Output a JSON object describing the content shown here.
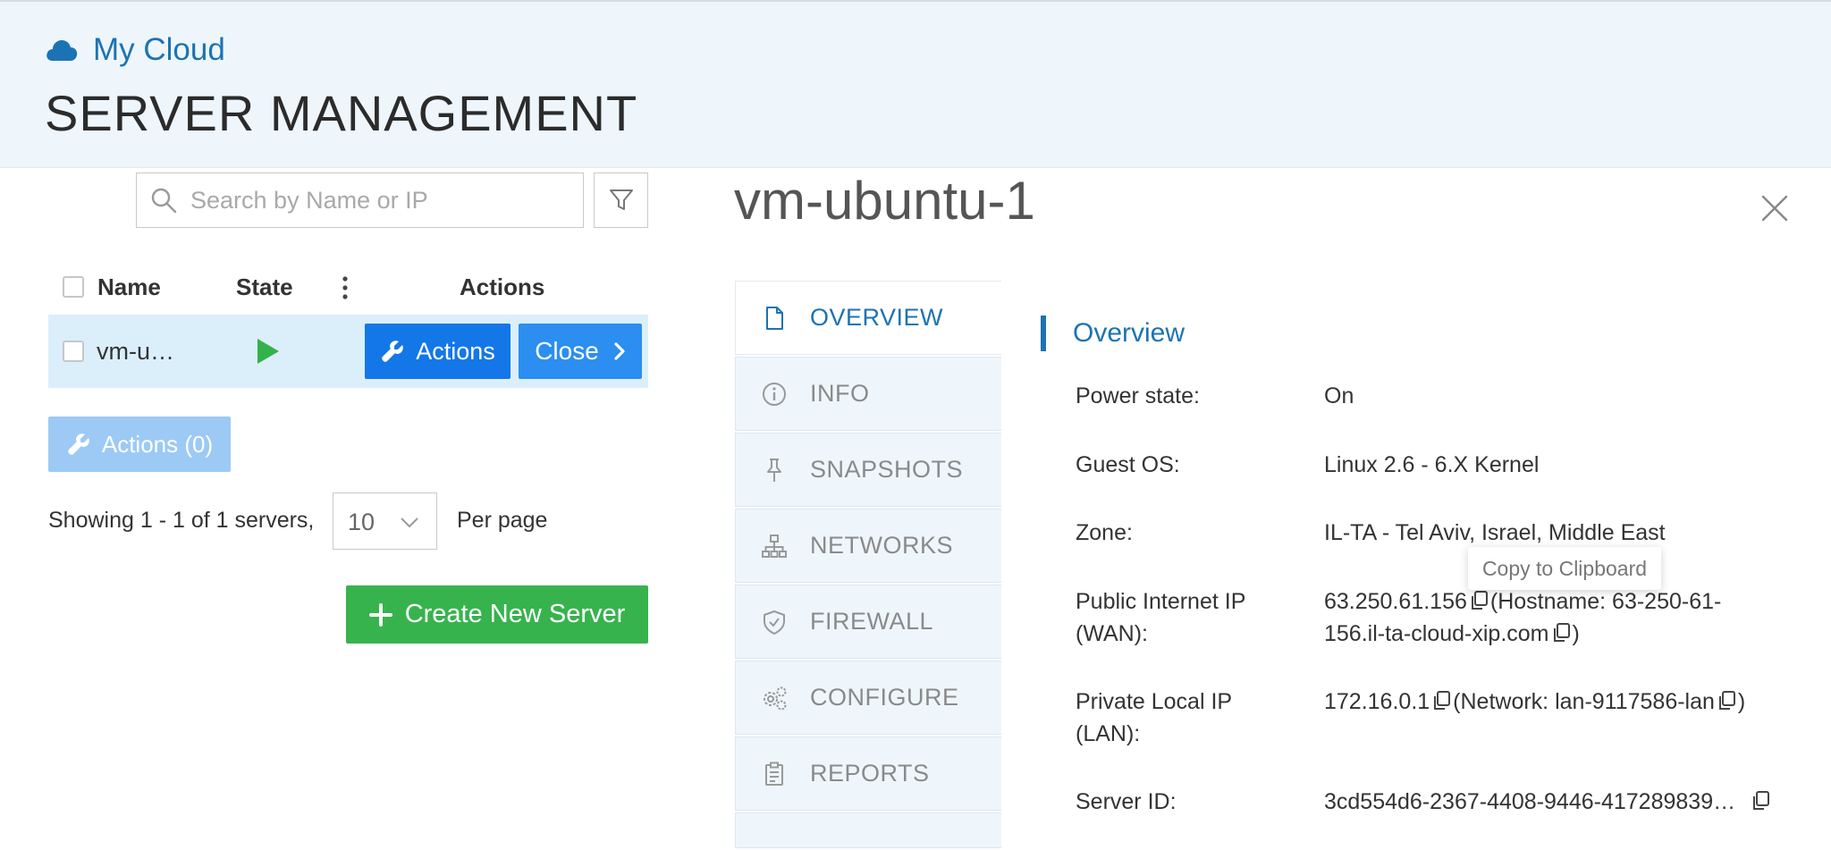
{
  "header": {
    "brand": "My Cloud",
    "title": "SERVER MANAGEMENT"
  },
  "search": {
    "placeholder": "Search by Name or IP"
  },
  "table": {
    "columns": [
      "Name",
      "State",
      "Actions"
    ],
    "rows": [
      {
        "name": "vm-u…",
        "state": "running",
        "actions_label": "Actions",
        "close_label": "Close"
      }
    ]
  },
  "bulk_actions_label": "Actions (0)",
  "pagination": {
    "showing": "Showing 1 - 1 of 1 servers,",
    "per_page_value": "10",
    "per_page_label": "Per page"
  },
  "create_button_label": "Create New Server",
  "detail": {
    "vm_name": "vm-ubuntu-1",
    "tabs": [
      {
        "label": "OVERVIEW",
        "icon": "document-icon",
        "active": true
      },
      {
        "label": "INFO",
        "icon": "info-icon",
        "active": false
      },
      {
        "label": "SNAPSHOTS",
        "icon": "pin-icon",
        "active": false
      },
      {
        "label": "NETWORKS",
        "icon": "network-icon",
        "active": false
      },
      {
        "label": "FIREWALL",
        "icon": "shield-icon",
        "active": false
      },
      {
        "label": "CONFIGURE",
        "icon": "gears-icon",
        "active": false
      },
      {
        "label": "REPORTS",
        "icon": "clipboard-icon",
        "active": false
      }
    ],
    "section_title": "Overview",
    "fields": {
      "power_state": {
        "label": "Power state:",
        "value": "On"
      },
      "guest_os": {
        "label": "Guest OS:",
        "value": "Linux 2.6 - 6.X Kernel"
      },
      "zone": {
        "label": "Zone:",
        "value": "IL-TA - Tel Aviv, Israel, Middle East"
      },
      "public_ip": {
        "label_line1": "Public Internet IP",
        "label_line2": "(WAN):",
        "ip": "63.250.61.156",
        "hostname_prefix": "(Hostname: 63-250-61-",
        "hostname_line2": "156.il-ta-cloud-xip.com",
        "closing": ")"
      },
      "private_ip": {
        "label_line1": "Private Local IP",
        "label_line2": "(LAN):",
        "ip": "172.16.0.1",
        "network": "(Network: lan-9117586-lan",
        "closing": ")"
      },
      "server_id": {
        "label": "Server ID:",
        "value": "3cd554d6-2367-4408-9446-417289839…"
      }
    }
  },
  "tooltip": "Copy to Clipboard",
  "colors": {
    "brand_blue": "#1c73b3",
    "primary_button": "#1477e8",
    "success_green": "#37b34e",
    "header_bg": "#eef6fc",
    "selected_row": "#dbeffb"
  }
}
